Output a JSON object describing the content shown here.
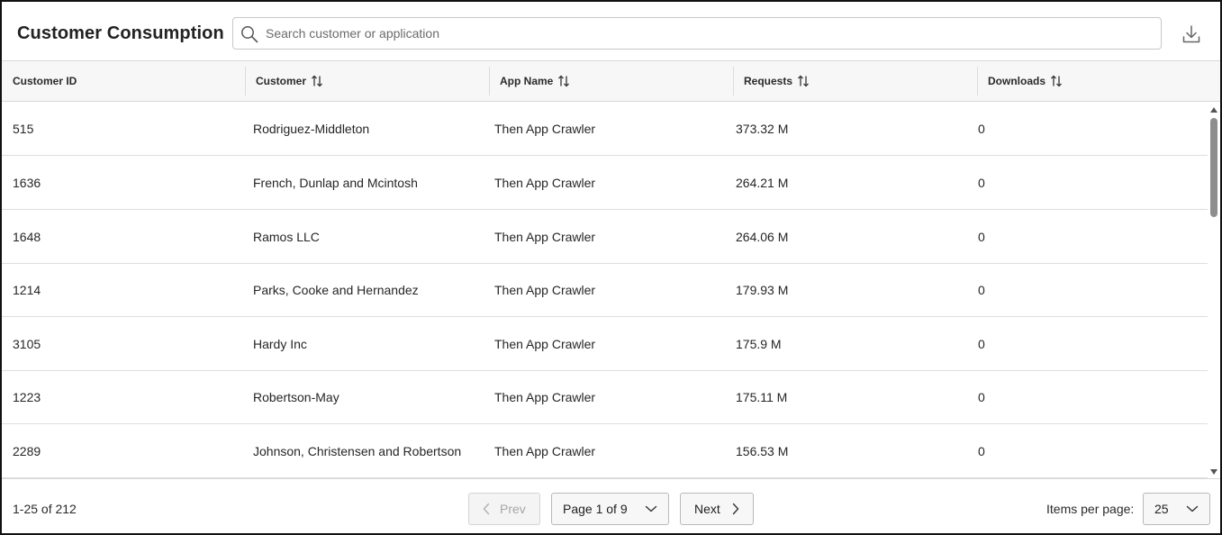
{
  "header": {
    "title": "Customer Consumption",
    "search_placeholder": "Search customer or application"
  },
  "icons": {
    "search": "search-icon",
    "download": "download-icon",
    "sort": "sort-icon",
    "chevron_left": "chevron-left-icon",
    "chevron_right": "chevron-right-icon",
    "chevron_down": "chevron-down-icon"
  },
  "table": {
    "columns": [
      {
        "label": "Customer ID",
        "sortable": false
      },
      {
        "label": "Customer",
        "sortable": true
      },
      {
        "label": "App Name",
        "sortable": true
      },
      {
        "label": "Requests",
        "sortable": true
      },
      {
        "label": "Downloads",
        "sortable": true
      }
    ],
    "rows": [
      [
        "515",
        "Rodriguez-Middleton",
        "Then App Crawler",
        "373.32 M",
        "0"
      ],
      [
        "1636",
        "French, Dunlap and Mcintosh",
        "Then App Crawler",
        "264.21 M",
        "0"
      ],
      [
        "1648",
        "Ramos LLC",
        "Then App Crawler",
        "264.06 M",
        "0"
      ],
      [
        "1214",
        "Parks, Cooke and Hernandez",
        "Then App Crawler",
        "179.93 M",
        "0"
      ],
      [
        "3105",
        "Hardy Inc",
        "Then App Crawler",
        "175.9 M",
        "0"
      ],
      [
        "1223",
        "Robertson-May",
        "Then App Crawler",
        "175.11 M",
        "0"
      ],
      [
        "2289",
        "Johnson, Christensen and Robertson",
        "Then App Crawler",
        "156.53 M",
        "0"
      ]
    ]
  },
  "footer": {
    "range": "1-25 of 212",
    "prev_label": "Prev",
    "page_label": "Page 1 of 9",
    "next_label": "Next",
    "items_per_page_label": "Items per page:",
    "items_per_page_value": "25"
  },
  "colors": {
    "header_bg": "#f7f7f7",
    "border": "#d8d8d8",
    "text": "#262626",
    "disabled": "#a6a6a6"
  }
}
